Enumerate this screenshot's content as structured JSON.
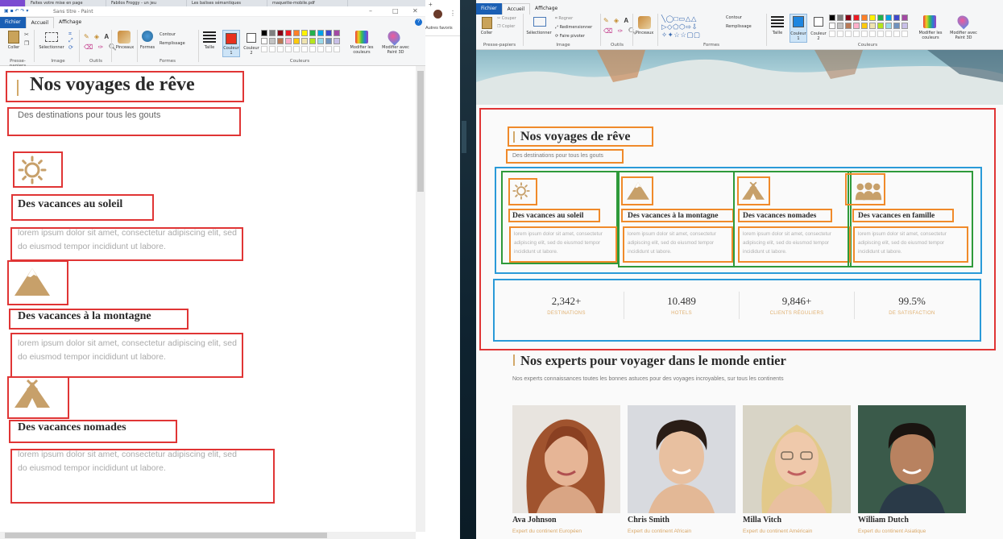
{
  "left_window": {
    "browser_tabs": [
      "",
      "Faites votre mise en page",
      "Fabilos Froggy - un jeu",
      "Les balises sémantiques",
      "maquette-mobile.pdf"
    ],
    "title": "Sans titre - Paint",
    "ribbon": {
      "tabs": [
        "Fichier",
        "Accueil",
        "Affichage"
      ],
      "tools": {
        "paste": "Coller",
        "select": "Sélectionner",
        "brushes": "Pinceaux",
        "shapes": "Formes",
        "outline": "Contour",
        "fill": "Remplissage",
        "size": "Taille",
        "color1": "Couleur 1",
        "color2": "Couleur 2",
        "edit_colors": "Modifier les couleurs",
        "paint3d": "Modifier avec Paint 3D"
      },
      "groups": [
        "Presse-papiers",
        "Image",
        "Outils",
        "Formes",
        "Couleurs"
      ]
    },
    "content": {
      "title": "Nos voyages de rêve",
      "subtitle": "Des destinations pour tous les gouts",
      "cards": [
        {
          "icon": "sun-icon",
          "title": "Des vacances au soleil",
          "text": "lorem ipsum dolor sit amet, consectetur adipiscing elit, sed do eiusmod tempor incididunt ut labore."
        },
        {
          "icon": "mountain-icon",
          "title": "Des vacances à la montagne",
          "text": "lorem ipsum dolor sit amet, consectetur adipiscing elit, sed do eiusmod tempor incididunt ut labore."
        },
        {
          "icon": "tent-icon",
          "title": "Des vacances nomades",
          "text": "lorem ipsum dolor sit amet, consectetur adipiscing elit, sed do eiusmod tempor incididunt ut labore."
        }
      ]
    }
  },
  "middle": {
    "bookmarks": "Autres favoris"
  },
  "right_window": {
    "ribbon": {
      "tabs": [
        "Fichier",
        "Accueil",
        "Affichage"
      ],
      "tools": {
        "paste": "Coller",
        "cut": "Couper",
        "copy": "Copier",
        "select": "Sélectionner",
        "crop": "Rogner",
        "resize": "Redimensionner",
        "rotate": "Faire pivoter",
        "brushes": "Pinceaux",
        "shapes": "Formes",
        "outline": "Contour",
        "fill": "Remplissage",
        "size": "Taille",
        "color1": "Couleur 1",
        "color2": "Couleur 2",
        "edit_colors": "Modifier les couleurs",
        "paint3d": "Modifier avec Paint 3D"
      },
      "groups": [
        "Presse-papiers",
        "Image",
        "Outils",
        "Formes",
        "Couleurs"
      ]
    },
    "content": {
      "title": "Nos voyages de rêve",
      "subtitle": "Des destinations pour tous les gouts",
      "cards": [
        {
          "icon": "sun-icon",
          "title": "Des vacances au soleil",
          "text": "lorem ipsum dolor sit amet, consectetur adipiscing elit, sed do eiusmod tempor incididunt ut labore."
        },
        {
          "icon": "mountain-icon",
          "title": "Des vacances à la montagne",
          "text": "lorem ipsum dolor sit amet, consectetur adipiscing elit, sed do eiusmod tempor incididunt ut labore."
        },
        {
          "icon": "tent-icon",
          "title": "Des vacances nomades",
          "text": "lorem ipsum dolor sit amet, consectetur adipiscing elit, sed do eiusmod tempor incididunt ut labore."
        },
        {
          "icon": "family-icon",
          "title": "Des vacances en famille",
          "text": "lorem ipsum dolor sit amet, consectetur adipiscing elit, sed do eiusmod tempor incididunt ut labore."
        }
      ],
      "stats": [
        {
          "value": "2,342+",
          "label": "DESTINATIONS"
        },
        {
          "value": "10.489",
          "label": "HOTELS"
        },
        {
          "value": "9,846+",
          "label": "CLIENTS RÉGULIERS"
        },
        {
          "value": "99.5%",
          "label": "DE SATISFACTION"
        }
      ],
      "experts_title": "Nos experts pour voyager dans le monde entier",
      "experts_subtitle": "Nos experts connaissances toutes les bonnes astuces pour des voyages incroyables, sur tous les continents",
      "experts": [
        {
          "name": "Ava Johnson",
          "role": "Expert du continent Européen"
        },
        {
          "name": "Chris Smith",
          "role": "Expert du continent Africain"
        },
        {
          "name": "Milla Vitch",
          "role": "Expert du continent Américain"
        },
        {
          "name": "William Dutch",
          "role": "Expert du continent Asiatique"
        }
      ]
    }
  },
  "colors": {
    "accent_gold": "#d2a96a",
    "annot_red": "#e03535",
    "annot_orange": "#f08a2a",
    "annot_green": "#2e9a3a",
    "annot_blue": "#2a9ad8",
    "paint_blue": "#1a5fb4"
  }
}
